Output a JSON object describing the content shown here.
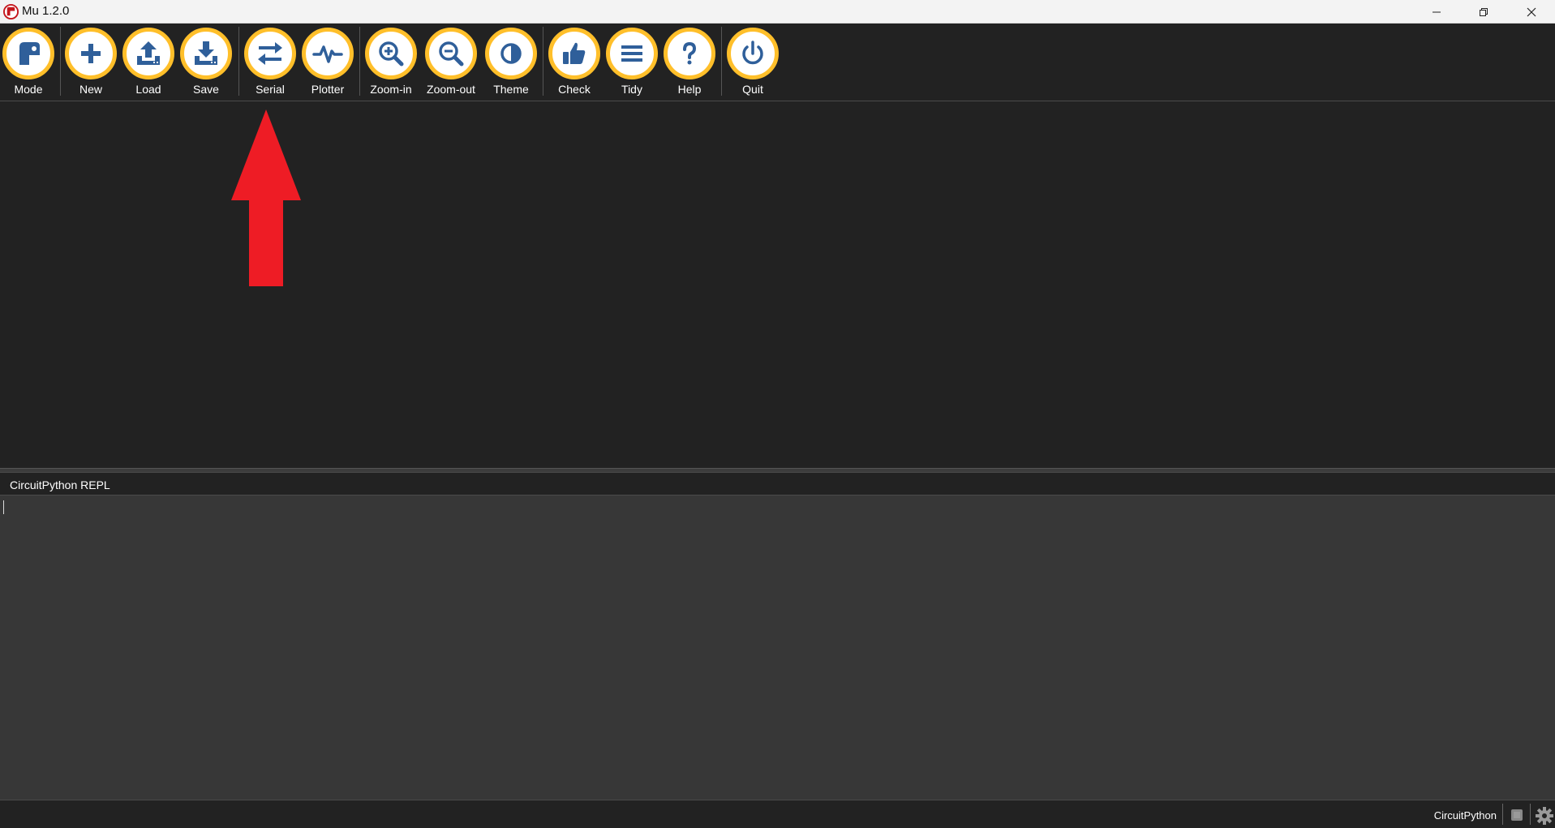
{
  "window": {
    "title": "Mu 1.2.0"
  },
  "toolbar": {
    "buttons": [
      {
        "id": "mode",
        "label": "Mode",
        "icon": "mode-icon"
      },
      {
        "id": "new",
        "label": "New",
        "icon": "plus-icon"
      },
      {
        "id": "load",
        "label": "Load",
        "icon": "upload-icon"
      },
      {
        "id": "save",
        "label": "Save",
        "icon": "download-icon"
      },
      {
        "id": "serial",
        "label": "Serial",
        "icon": "swap-arrows-icon"
      },
      {
        "id": "plotter",
        "label": "Plotter",
        "icon": "pulse-icon"
      },
      {
        "id": "zoom-in",
        "label": "Zoom-in",
        "icon": "zoom-in-icon"
      },
      {
        "id": "zoom-out",
        "label": "Zoom-out",
        "icon": "zoom-out-icon"
      },
      {
        "id": "theme",
        "label": "Theme",
        "icon": "half-circle-icon"
      },
      {
        "id": "check",
        "label": "Check",
        "icon": "thumbs-up-icon"
      },
      {
        "id": "tidy",
        "label": "Tidy",
        "icon": "lines-icon"
      },
      {
        "id": "help",
        "label": "Help",
        "icon": "question-icon"
      },
      {
        "id": "quit",
        "label": "Quit",
        "icon": "power-icon"
      }
    ]
  },
  "repl": {
    "title": "CircuitPython REPL"
  },
  "statusbar": {
    "mode": "CircuitPython"
  },
  "colors": {
    "button_ring": "#ffbf2a",
    "icon_blue": "#2f5f9a",
    "annotation_arrow": "#ee1c25"
  }
}
